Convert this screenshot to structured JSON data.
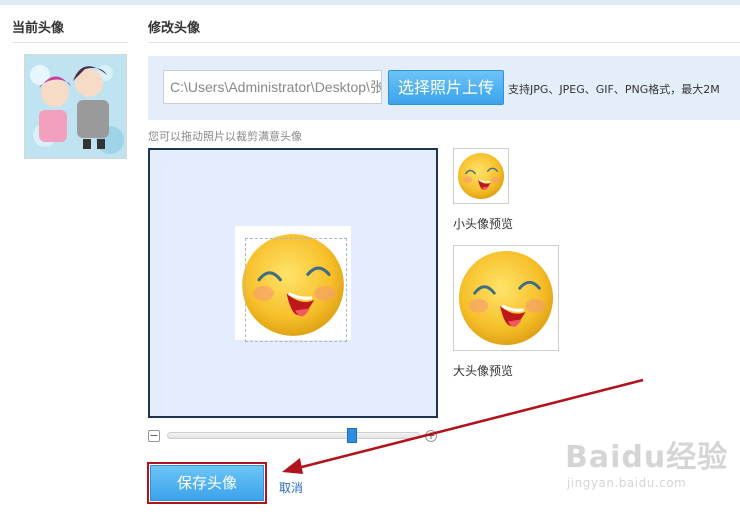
{
  "left_column": {
    "title": "当前头像"
  },
  "right_column": {
    "title": "修改头像"
  },
  "upload": {
    "file_path_value": "C:\\Users\\Administrator\\Desktop\\张",
    "upload_button_label": "选择照片上传",
    "format_hint": "支持JPG、JPEG、GIF、PNG格式，最大2M"
  },
  "crop": {
    "hint": "您可以拖动照片以裁剪满意头像",
    "zoom_level": 0.74
  },
  "previews": {
    "small_label": "小头像预览",
    "large_label": "大头像预览"
  },
  "actions": {
    "save_label": "保存头像",
    "cancel_label": "取消"
  },
  "watermark": {
    "main": "Baidu经验",
    "sub": "jingyan.baidu.com"
  },
  "icons": {
    "zoom_out": "minus-icon",
    "zoom_in": "plus-icon"
  },
  "colors": {
    "accent": "#3ba3ea",
    "highlight": "#b0131b",
    "panel": "#e4eefb"
  }
}
